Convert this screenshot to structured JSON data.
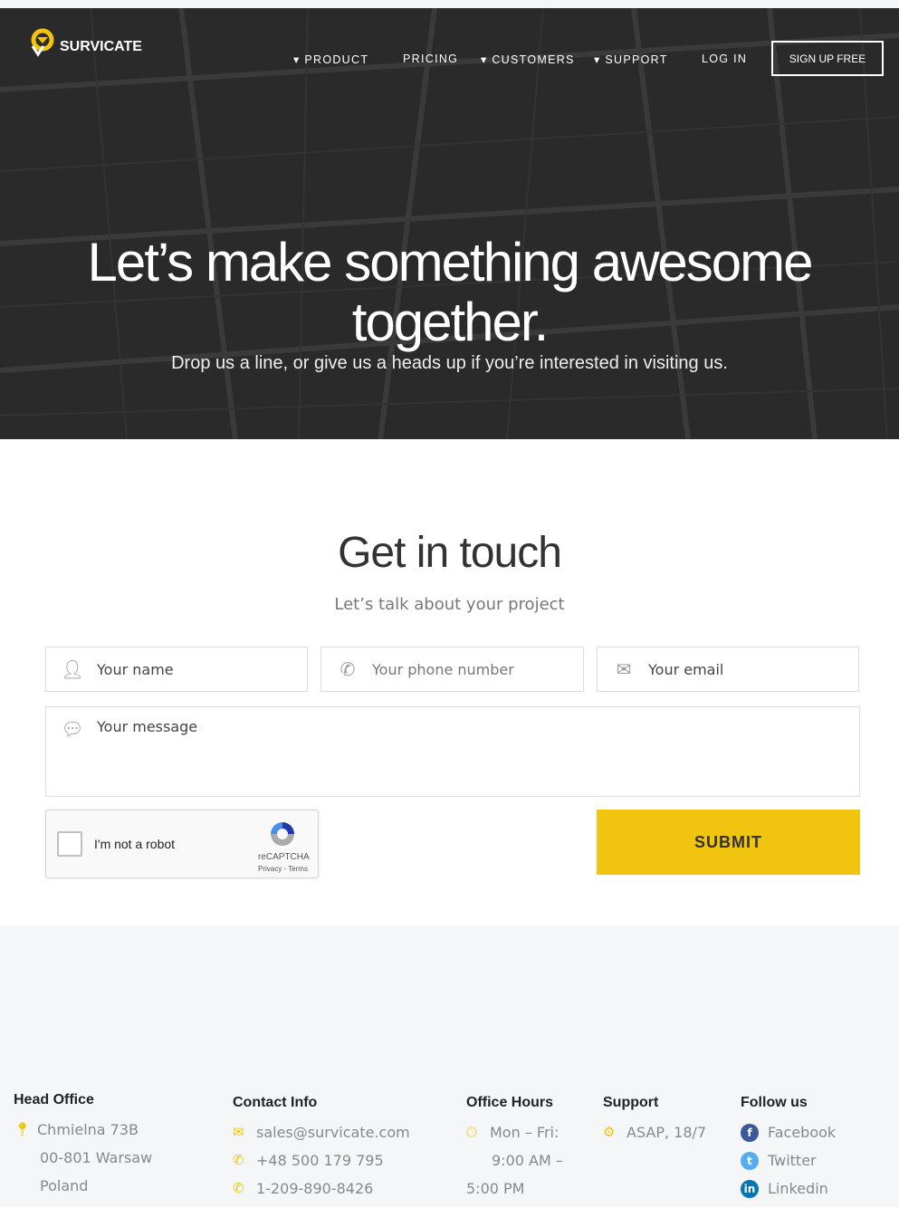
{
  "nav": {
    "logo": "SURVICATE",
    "items": [
      "PRODUCT",
      "PRICING",
      "CUSTOMERS",
      "SUPPORT",
      "LOG IN"
    ],
    "signup": "SIGN UP FREE"
  },
  "hero": {
    "title_line1": "Let’s make something awesome",
    "title_line2": "together.",
    "subtitle": "Drop us a line, or give us a heads up if you’re interested in visiting us."
  },
  "contact": {
    "title": "Get in touch",
    "subtitle": "Let’s talk about your project",
    "name_placeholder": "Your name",
    "phone_placeholder": "Your phone number",
    "email_placeholder": "Your email",
    "message_placeholder": "Your message",
    "captcha_label": "I'm not a robot",
    "captcha_brand": "reCAPTCHA",
    "captcha_links": "Privacy - Terms",
    "submit": "SUBMIT"
  },
  "footer": {
    "head_office": {
      "title": "Head Office",
      "lines": [
        "Chmielna 73B",
        "00-801 Warsaw",
        "Poland"
      ]
    },
    "contact_info": {
      "title": "Contact Info",
      "email": "sales@survicate.com",
      "phone1": "+48 500 179 795",
      "phone2": "1-209-890-8426"
    },
    "office_hours": {
      "title": "Office Hours",
      "lines": [
        "Mon – Fri:",
        "9:00 AM –",
        "5:00 PM"
      ]
    },
    "support": {
      "title": "Support",
      "text": "ASAP, 18/7"
    },
    "follow": {
      "title": "Follow us",
      "links": [
        "Facebook",
        "Twitter",
        "Linkedin"
      ]
    }
  },
  "colors": {
    "accent": "#f1c40f",
    "hero_bg": "#2a2a2a",
    "footer_bg": "#f5f6f8",
    "facebook": "#3b5998",
    "twitter": "#55acee",
    "linkedin": "#0077b5"
  }
}
